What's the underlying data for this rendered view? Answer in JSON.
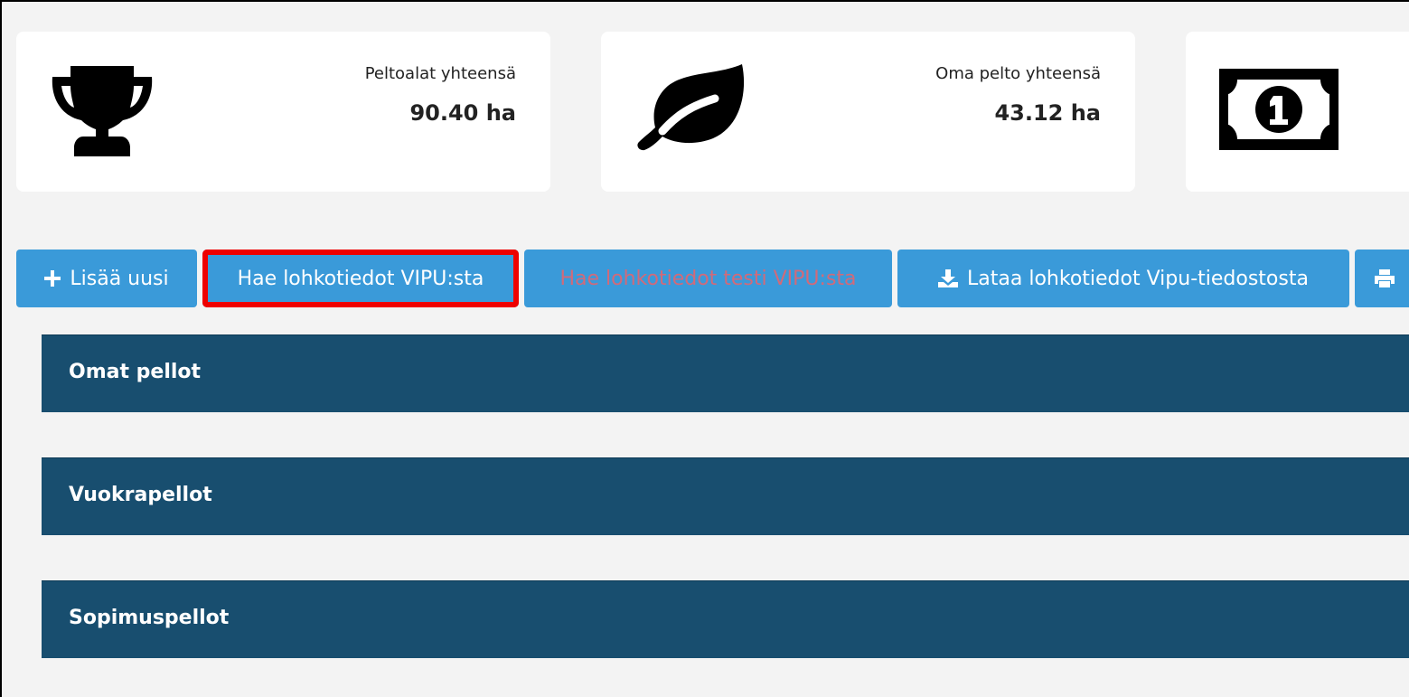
{
  "stats": [
    {
      "label": "Peltoalat yhteensä",
      "value": "90.40 ha",
      "icon": "trophy-icon"
    },
    {
      "label": "Oma pelto yhteensä",
      "value": "43.12 ha",
      "icon": "leaf-icon"
    },
    {
      "label": "",
      "value": "",
      "icon": "money-bill-icon"
    }
  ],
  "toolbar": {
    "add_new": "Lisää uusi",
    "fetch_vipu": "Hae lohkotiedot VIPU:sta",
    "fetch_test_vipu": "Hae lohkotiedot testi VIPU:sta",
    "load_file": "Lataa lohkotiedot Vipu-tiedostosta"
  },
  "sections": [
    {
      "title": "Omat pellot"
    },
    {
      "title": "Vuokrapellot"
    },
    {
      "title": "Sopimuspellot"
    }
  ],
  "colors": {
    "button": "#3a9ad9",
    "section_header": "#184e6f",
    "highlight": "#ee0000"
  }
}
